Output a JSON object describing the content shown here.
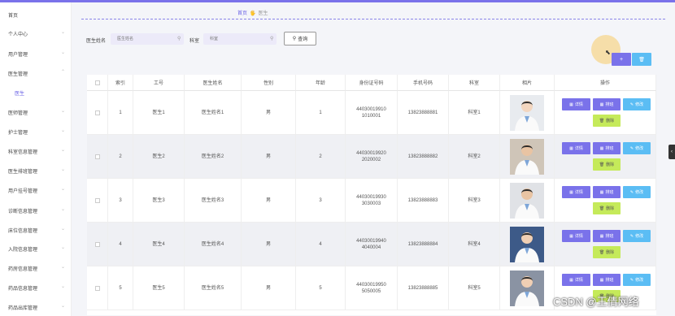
{
  "sidebar": {
    "items": [
      {
        "label": "首页",
        "chev": ""
      },
      {
        "label": "个人中心",
        "chev": "⌄"
      },
      {
        "label": "用户管理",
        "chev": "⌄"
      },
      {
        "label": "医生管理",
        "chev": "⌃"
      },
      {
        "label": "医生",
        "chev": ""
      },
      {
        "label": "医师管理",
        "chev": "⌄"
      },
      {
        "label": "护士管理",
        "chev": "⌄"
      },
      {
        "label": "科室信息管理",
        "chev": "⌄"
      },
      {
        "label": "医生排班管理",
        "chev": "⌄"
      },
      {
        "label": "用户挂号管理",
        "chev": "⌄"
      },
      {
        "label": "诊断信息管理",
        "chev": "⌄"
      },
      {
        "label": "床位信息管理",
        "chev": "⌄"
      },
      {
        "label": "入院信息管理",
        "chev": "⌄"
      },
      {
        "label": "药房信息管理",
        "chev": "⌄"
      },
      {
        "label": "药品信息管理",
        "chev": "⌄"
      },
      {
        "label": "药品出库管理",
        "chev": "⌄"
      }
    ]
  },
  "breadcrumb": {
    "home": "首页",
    "sep": "🖐",
    "current": "医生"
  },
  "search": {
    "name_label": "医生姓名",
    "name_placeholder": "医生姓名",
    "dept_label": "科室",
    "dept_placeholder": "科室",
    "query_label": "查询",
    "icon": "search-icon"
  },
  "toolbar": {
    "add_label": "+",
    "delete_label": "🗑"
  },
  "table": {
    "headers": [
      "",
      "索引",
      "工号",
      "医生姓名",
      "性别",
      "年龄",
      "身份证号码",
      "手机号码",
      "科室",
      "相片",
      "操作"
    ],
    "rows": [
      {
        "idx": "1",
        "id": "医生1",
        "name": "医生姓名1",
        "gender": "男",
        "age": "1",
        "idcard": "440300199101010001",
        "phone": "13823888881",
        "dept": "科室1"
      },
      {
        "idx": "2",
        "id": "医生2",
        "name": "医生姓名2",
        "gender": "男",
        "age": "2",
        "idcard": "440300199202020002",
        "phone": "13823888882",
        "dept": "科室2"
      },
      {
        "idx": "3",
        "id": "医生3",
        "name": "医生姓名3",
        "gender": "男",
        "age": "3",
        "idcard": "440300199303030003",
        "phone": "13823888883",
        "dept": "科室3"
      },
      {
        "idx": "4",
        "id": "医生4",
        "name": "医生姓名4",
        "gender": "男",
        "age": "4",
        "idcard": "440300199404040004",
        "phone": "13823888884",
        "dept": "科室4"
      },
      {
        "idx": "5",
        "id": "医生5",
        "name": "医生姓名5",
        "gender": "男",
        "age": "5",
        "idcard": "440300199505050005",
        "phone": "13823888885",
        "dept": "科室5"
      }
    ],
    "actions": {
      "detail": "详情",
      "schedule": "排班",
      "edit": "修改",
      "remove": "删除"
    }
  },
  "watermark": "CSDN @王倩网络",
  "colors": {
    "accent": "#7a72ea",
    "info": "#5bbdf4",
    "danger": "#c5ea5a"
  }
}
